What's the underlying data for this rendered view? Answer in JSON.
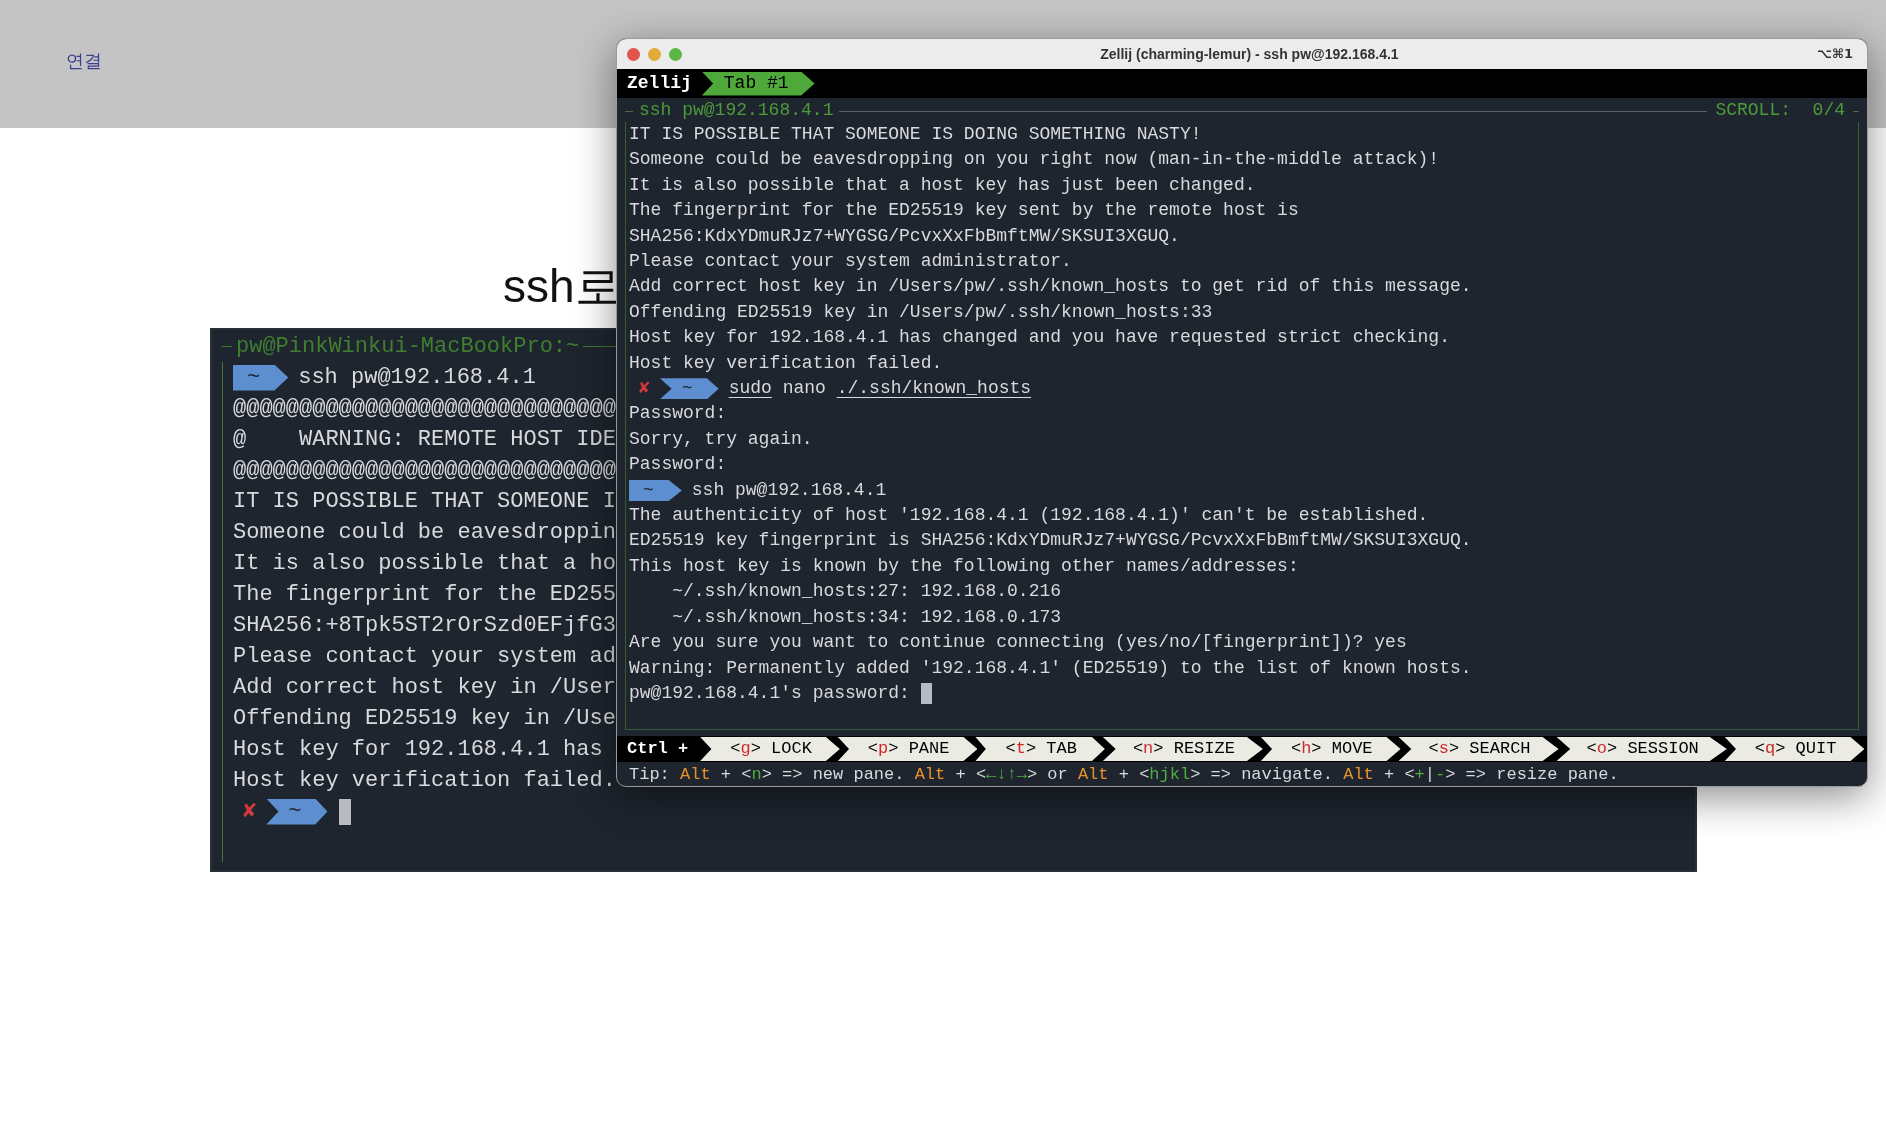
{
  "page": {
    "nav_link": "연결",
    "heading": "ssh로"
  },
  "back_terminal": {
    "pane_title": "pw@PinkWinkui-MacBookPro:~",
    "lines": [
      {
        "kind": "prompt",
        "dir": "~",
        "command": [
          {
            "text": "ssh pw@192.168.4.1",
            "underline": false
          }
        ]
      },
      {
        "kind": "text",
        "text": "@@@@@@@@@@@@@@@@@@@@@@@@@@@@@"
      },
      {
        "kind": "text",
        "text": "@    WARNING: REMOTE HOST IDE"
      },
      {
        "kind": "text",
        "text": "@@@@@@@@@@@@@@@@@@@@@@@@@@@@@"
      },
      {
        "kind": "text",
        "text": "IT IS POSSIBLE THAT SOMEONE I"
      },
      {
        "kind": "text",
        "text": "Someone could be eavesdroppin"
      },
      {
        "kind": "text",
        "text": "It is also possible that a ho"
      },
      {
        "kind": "text",
        "text": "The fingerprint for the ED255"
      },
      {
        "kind": "text",
        "text": "SHA256:+8Tpk5ST2rOrSzd0EFjfG3"
      },
      {
        "kind": "text",
        "text": "Please contact your system ad"
      },
      {
        "kind": "text",
        "text": "Add correct host key in /User"
      },
      {
        "kind": "text",
        "text": "Offending ED25519 key in /Use"
      },
      {
        "kind": "text",
        "text": "Host key for 192.168.4.1 has"
      },
      {
        "kind": "text",
        "text": "Host key verification failed."
      },
      {
        "kind": "prompt",
        "fail_mark": "✘",
        "dir": "~",
        "cursor": true
      }
    ]
  },
  "window": {
    "title": "Zellij (charming-lemur) - ssh pw@192.168.4.1",
    "shortcut": "⌥⌘1",
    "brand": "Zellij",
    "tabs": [
      {
        "label": "Tab #1",
        "selected": true
      }
    ],
    "pane": {
      "title": "ssh pw@192.168.4.1",
      "scroll": "SCROLL:  0/4",
      "lines": [
        {
          "kind": "text",
          "text": "IT IS POSSIBLE THAT SOMEONE IS DOING SOMETHING NASTY!"
        },
        {
          "kind": "text",
          "text": "Someone could be eavesdropping on you right now (man-in-the-middle attack)!"
        },
        {
          "kind": "text",
          "text": "It is also possible that a host key has just been changed."
        },
        {
          "kind": "text",
          "text": "The fingerprint for the ED25519 key sent by the remote host is"
        },
        {
          "kind": "text",
          "text": "SHA256:KdxYDmuRJz7+WYGSG/PcvxXxFbBmftMW/SKSUI3XGUQ."
        },
        {
          "kind": "text",
          "text": "Please contact your system administrator."
        },
        {
          "kind": "text",
          "text": "Add correct host key in /Users/pw/.ssh/known_hosts to get rid of this message."
        },
        {
          "kind": "text",
          "text": "Offending ED25519 key in /Users/pw/.ssh/known_hosts:33"
        },
        {
          "kind": "text",
          "text": "Host key for 192.168.4.1 has changed and you have requested strict checking."
        },
        {
          "kind": "text",
          "text": "Host key verification failed."
        },
        {
          "kind": "prompt",
          "fail_mark": "✘",
          "dir": "~",
          "command": [
            {
              "text": "sudo",
              "underline": true
            },
            {
              "text": " nano ",
              "underline": false
            },
            {
              "text": "./.ssh/known_hosts",
              "underline": true
            }
          ]
        },
        {
          "kind": "text",
          "text": "Password:"
        },
        {
          "kind": "text",
          "text": "Sorry, try again."
        },
        {
          "kind": "text",
          "text": "Password:"
        },
        {
          "kind": "prompt",
          "dir": "~",
          "command": [
            {
              "text": "ssh pw@192.168.4.1",
              "underline": false
            }
          ]
        },
        {
          "kind": "text",
          "text": "The authenticity of host '192.168.4.1 (192.168.4.1)' can't be established."
        },
        {
          "kind": "text",
          "text": "ED25519 key fingerprint is SHA256:KdxYDmuRJz7+WYGSG/PcvxXxFbBmftMW/SKSUI3XGUQ."
        },
        {
          "kind": "text",
          "text": "This host key is known by the following other names/addresses:"
        },
        {
          "kind": "text",
          "text": "    ~/.ssh/known_hosts:27: 192.168.0.216"
        },
        {
          "kind": "text",
          "text": "    ~/.ssh/known_hosts:34: 192.168.0.173"
        },
        {
          "kind": "text",
          "text": "Are you sure you want to continue connecting (yes/no/[fingerprint])? yes"
        },
        {
          "kind": "text",
          "text": "Warning: Permanently added '192.168.4.1' (ED25519) to the list of known hosts."
        },
        {
          "kind": "input",
          "text": "pw@192.168.4.1's password: ",
          "cursor": true
        }
      ]
    },
    "keybar": {
      "modifier": "Ctrl +",
      "keys": [
        {
          "open": "<",
          "letter": "g",
          "close": ">",
          "action": "LOCK"
        },
        {
          "open": "<",
          "letter": "p",
          "close": ">",
          "action": "PANE"
        },
        {
          "open": "<",
          "letter": "t",
          "close": ">",
          "action": "TAB"
        },
        {
          "open": "<",
          "letter": "n",
          "close": ">",
          "action": "RESIZE"
        },
        {
          "open": "<",
          "letter": "h",
          "close": ">",
          "action": "MOVE"
        },
        {
          "open": "<",
          "letter": "s",
          "close": ">",
          "action": "SEARCH"
        },
        {
          "open": "<",
          "letter": "o",
          "close": ">",
          "action": "SESSION"
        },
        {
          "open": "<",
          "letter": "q",
          "close": ">",
          "action": "QUIT"
        }
      ]
    },
    "tip": [
      {
        "kind": "plain",
        "text": "Tip: "
      },
      {
        "kind": "modifier",
        "text": "Alt"
      },
      {
        "kind": "plain",
        "text": " + <"
      },
      {
        "kind": "key",
        "text": "n"
      },
      {
        "kind": "plain",
        "text": "> => new pane. "
      },
      {
        "kind": "modifier",
        "text": "Alt"
      },
      {
        "kind": "plain",
        "text": " + <"
      },
      {
        "kind": "key",
        "text": "←↓↑→"
      },
      {
        "kind": "plain",
        "text": "> or "
      },
      {
        "kind": "modifier",
        "text": "Alt"
      },
      {
        "kind": "plain",
        "text": " + <"
      },
      {
        "kind": "key",
        "text": "hjkl"
      },
      {
        "kind": "plain",
        "text": "> => navigate. "
      },
      {
        "kind": "modifier",
        "text": "Alt"
      },
      {
        "kind": "plain",
        "text": " + <"
      },
      {
        "kind": "key",
        "text": "+"
      },
      {
        "kind": "plain",
        "text": "|"
      },
      {
        "kind": "key",
        "text": "-"
      },
      {
        "kind": "plain",
        "text": "> => resize pane."
      }
    ]
  }
}
